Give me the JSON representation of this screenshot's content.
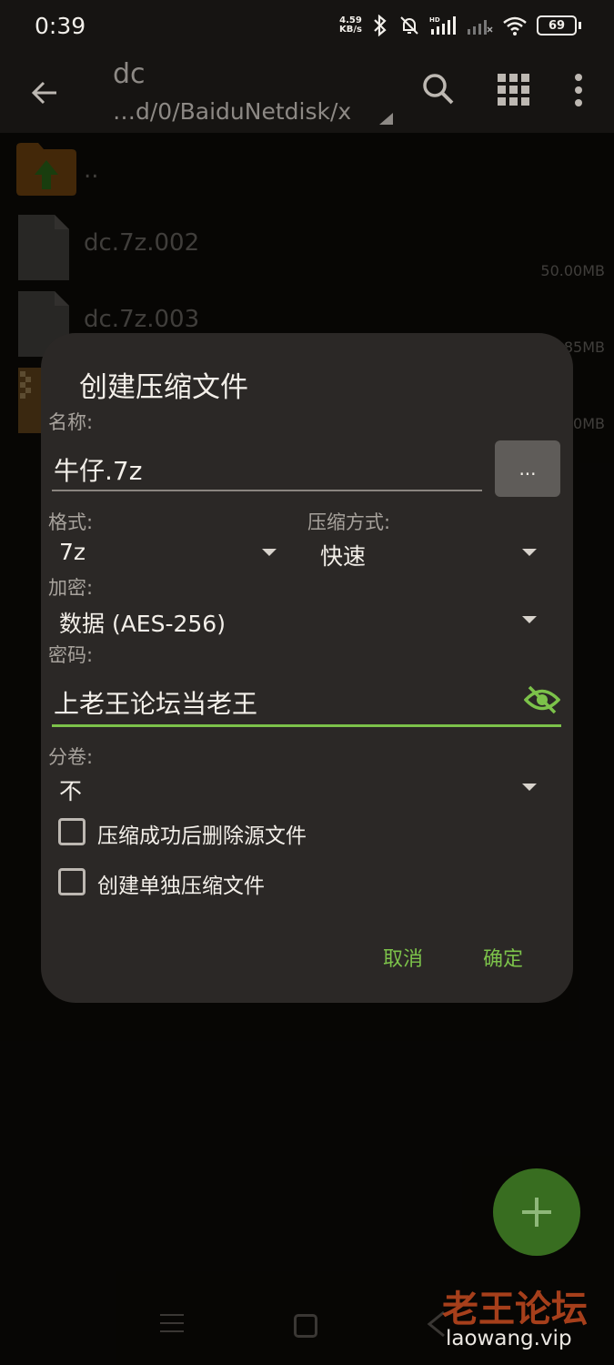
{
  "status_bar": {
    "time": "0:39",
    "net_speed_value": "4.59",
    "net_speed_unit": "KB/s",
    "battery": "69"
  },
  "app_bar": {
    "title": "dc",
    "path": "…d/0/BaiduNetdisk/x"
  },
  "files": [
    {
      "name": "..",
      "size": ""
    },
    {
      "name": "dc.7z.002",
      "size": "50.00MB"
    },
    {
      "name": "dc.7z.003",
      "size": "85MB"
    },
    {
      "name": "",
      "size": "0MB"
    }
  ],
  "dialog": {
    "title": "创建压缩文件",
    "name_label": "名称:",
    "name_value": "牛仔.7z",
    "browse_label": "...",
    "format_label": "格式:",
    "format_value": "7z",
    "method_label": "压缩方式:",
    "method_value": "快速",
    "encryption_label": "加密:",
    "encryption_value": "数据 (AES-256)",
    "password_label": "密码:",
    "password_value": "上老王论坛当老王",
    "volume_label": "分卷:",
    "volume_value": "不",
    "checkbox_delete_source": "压缩成功后删除源文件",
    "checkbox_separate": "创建单独压缩文件",
    "cancel": "取消",
    "ok": "确定"
  },
  "watermark": {
    "cn": "老王论坛",
    "en": "laowang.vip"
  },
  "colors": {
    "accent": "#7cc24a",
    "fab": "#386d20",
    "dialog_bg": "#2b2826"
  }
}
